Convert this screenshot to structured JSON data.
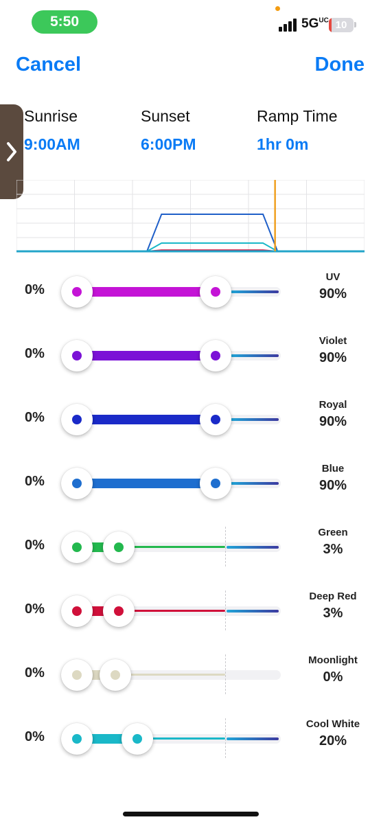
{
  "status_bar": {
    "time": "5:50",
    "network": "5G",
    "network_suffix": "UC",
    "battery": "10",
    "battery_level_fraction": 0.1,
    "colors": {
      "time_pill": "#3cc85a",
      "battery_low": "#e5483f"
    }
  },
  "nav": {
    "cancel_label": "Cancel",
    "done_label": "Done",
    "accent_color": "#0a7bf5"
  },
  "schedule": {
    "sunrise_label": "Sunrise",
    "sunrise_value": "9:00AM",
    "sunset_label": "Sunset",
    "sunset_value": "6:00PM",
    "ramp_label": "Ramp Time",
    "ramp_value": "1hr 0m"
  },
  "chart_data": {
    "type": "line",
    "title": "",
    "x_range": [
      0,
      24
    ],
    "y_range": [
      0,
      100
    ],
    "grid": true,
    "current_time_marker_hours": 17.83,
    "series": [
      {
        "color": "#1f5fc8",
        "points": [
          [
            0,
            0
          ],
          [
            9,
            0
          ],
          [
            10,
            90
          ],
          [
            17,
            90
          ],
          [
            18,
            0
          ],
          [
            24,
            0
          ]
        ]
      },
      {
        "color": "#1ab8c8",
        "points": [
          [
            0,
            0
          ],
          [
            9,
            0
          ],
          [
            10,
            20
          ],
          [
            17,
            20
          ],
          [
            18,
            0
          ],
          [
            24,
            0
          ]
        ]
      },
      {
        "color": "#d0103a",
        "points": [
          [
            0,
            0
          ],
          [
            9,
            0
          ],
          [
            10,
            3
          ],
          [
            17,
            3
          ],
          [
            18,
            0
          ],
          [
            24,
            0
          ]
        ]
      }
    ]
  },
  "channels": [
    {
      "id": "uv",
      "min": "0%",
      "name": "UV",
      "value": "90%",
      "fraction": 0.9,
      "color": "#c414d6",
      "type": "high"
    },
    {
      "id": "violet",
      "min": "0%",
      "name": "Violet",
      "value": "90%",
      "fraction": 0.9,
      "color": "#7b12d6",
      "type": "high"
    },
    {
      "id": "royal",
      "min": "0%",
      "name": "Royal",
      "value": "90%",
      "fraction": 0.9,
      "color": "#1a2ac8",
      "type": "high"
    },
    {
      "id": "blue",
      "min": "0%",
      "name": "Blue",
      "value": "90%",
      "fraction": 0.9,
      "color": "#1e6ecf",
      "type": "high"
    },
    {
      "id": "green",
      "min": "0%",
      "name": "Green",
      "value": "3%",
      "fraction": 0.03,
      "color": "#23b84e",
      "type": "low"
    },
    {
      "id": "deep-red",
      "min": "0%",
      "name": "Deep Red",
      "value": "3%",
      "fraction": 0.03,
      "color": "#d0103a",
      "type": "low"
    },
    {
      "id": "moonlight",
      "min": "0%",
      "name": "Moonlight",
      "value": "0%",
      "fraction": 0.0,
      "color": "#ddd9c2",
      "type": "off"
    },
    {
      "id": "cool-white",
      "min": "0%",
      "name": "Cool White",
      "value": "20%",
      "fraction": 0.2,
      "color": "#1ab8c8",
      "type": "mid"
    }
  ]
}
